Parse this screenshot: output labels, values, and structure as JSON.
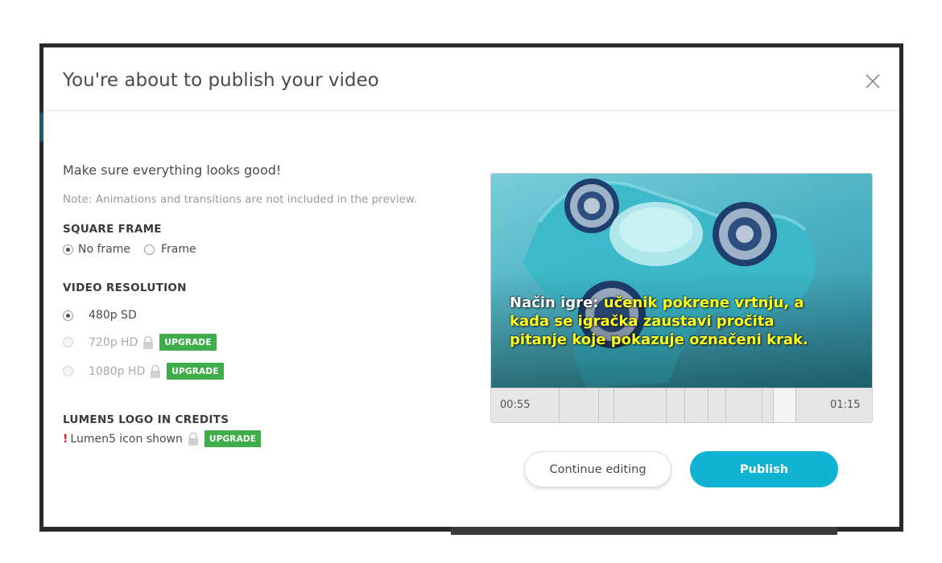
{
  "modal": {
    "title": "You're about to publish your video",
    "close_icon": "close-icon",
    "intro": "Make sure everything looks good!",
    "note": "Note: Animations and transitions are not included in the preview."
  },
  "square_frame": {
    "title": "SQUARE FRAME",
    "options": [
      {
        "label": "No frame",
        "selected": true
      },
      {
        "label": "Frame",
        "selected": false
      }
    ]
  },
  "video_resolution": {
    "title": "VIDEO RESOLUTION",
    "options": [
      {
        "label": "480p SD",
        "selected": true,
        "locked": false
      },
      {
        "label": "720p HD",
        "selected": false,
        "locked": true,
        "badge": "UPGRADE"
      },
      {
        "label": "1080p HD",
        "selected": false,
        "locked": true,
        "badge": "UPGRADE"
      }
    ]
  },
  "logo_credits": {
    "title": "LUMEN5 LOGO IN CREDITS",
    "warning": "!",
    "label": "Lumen5 icon shown",
    "badge": "UPGRADE"
  },
  "preview": {
    "caption_white": "Način igre: ",
    "caption_yellow": "učenik pokrene vrtnju, a kada se igračka zaustavi pročita pitanje koje pokazuje označeni krak.",
    "time_start": "00:55",
    "time_end": "01:15"
  },
  "actions": {
    "continue_label": "Continue editing",
    "publish_label": "Publish"
  },
  "colors": {
    "accent": "#10b3d3",
    "upgrade": "#3fae4a",
    "warning": "#e0201b",
    "caption_highlight": "#ffff1e"
  }
}
